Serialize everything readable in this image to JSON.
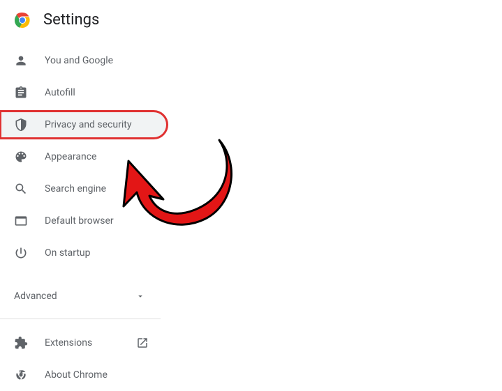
{
  "header": {
    "title": "Settings"
  },
  "sidebar": {
    "items": [
      {
        "id": "you-and-google",
        "label": "You and Google"
      },
      {
        "id": "autofill",
        "label": "Autofill"
      },
      {
        "id": "privacy-and-security",
        "label": "Privacy and security",
        "selected": true,
        "highlighted": true
      },
      {
        "id": "appearance",
        "label": "Appearance"
      },
      {
        "id": "search-engine",
        "label": "Search engine"
      },
      {
        "id": "default-browser",
        "label": "Default browser"
      },
      {
        "id": "on-startup",
        "label": "On startup"
      }
    ]
  },
  "advanced": {
    "label": "Advanced"
  },
  "bottom": {
    "items": [
      {
        "id": "extensions",
        "label": "Extensions",
        "external": true
      },
      {
        "id": "about-chrome",
        "label": "About Chrome"
      }
    ]
  },
  "annotation": {
    "type": "curved-arrow",
    "color": "#e31616",
    "stroke": "#000000",
    "points_to": "privacy-and-security"
  }
}
